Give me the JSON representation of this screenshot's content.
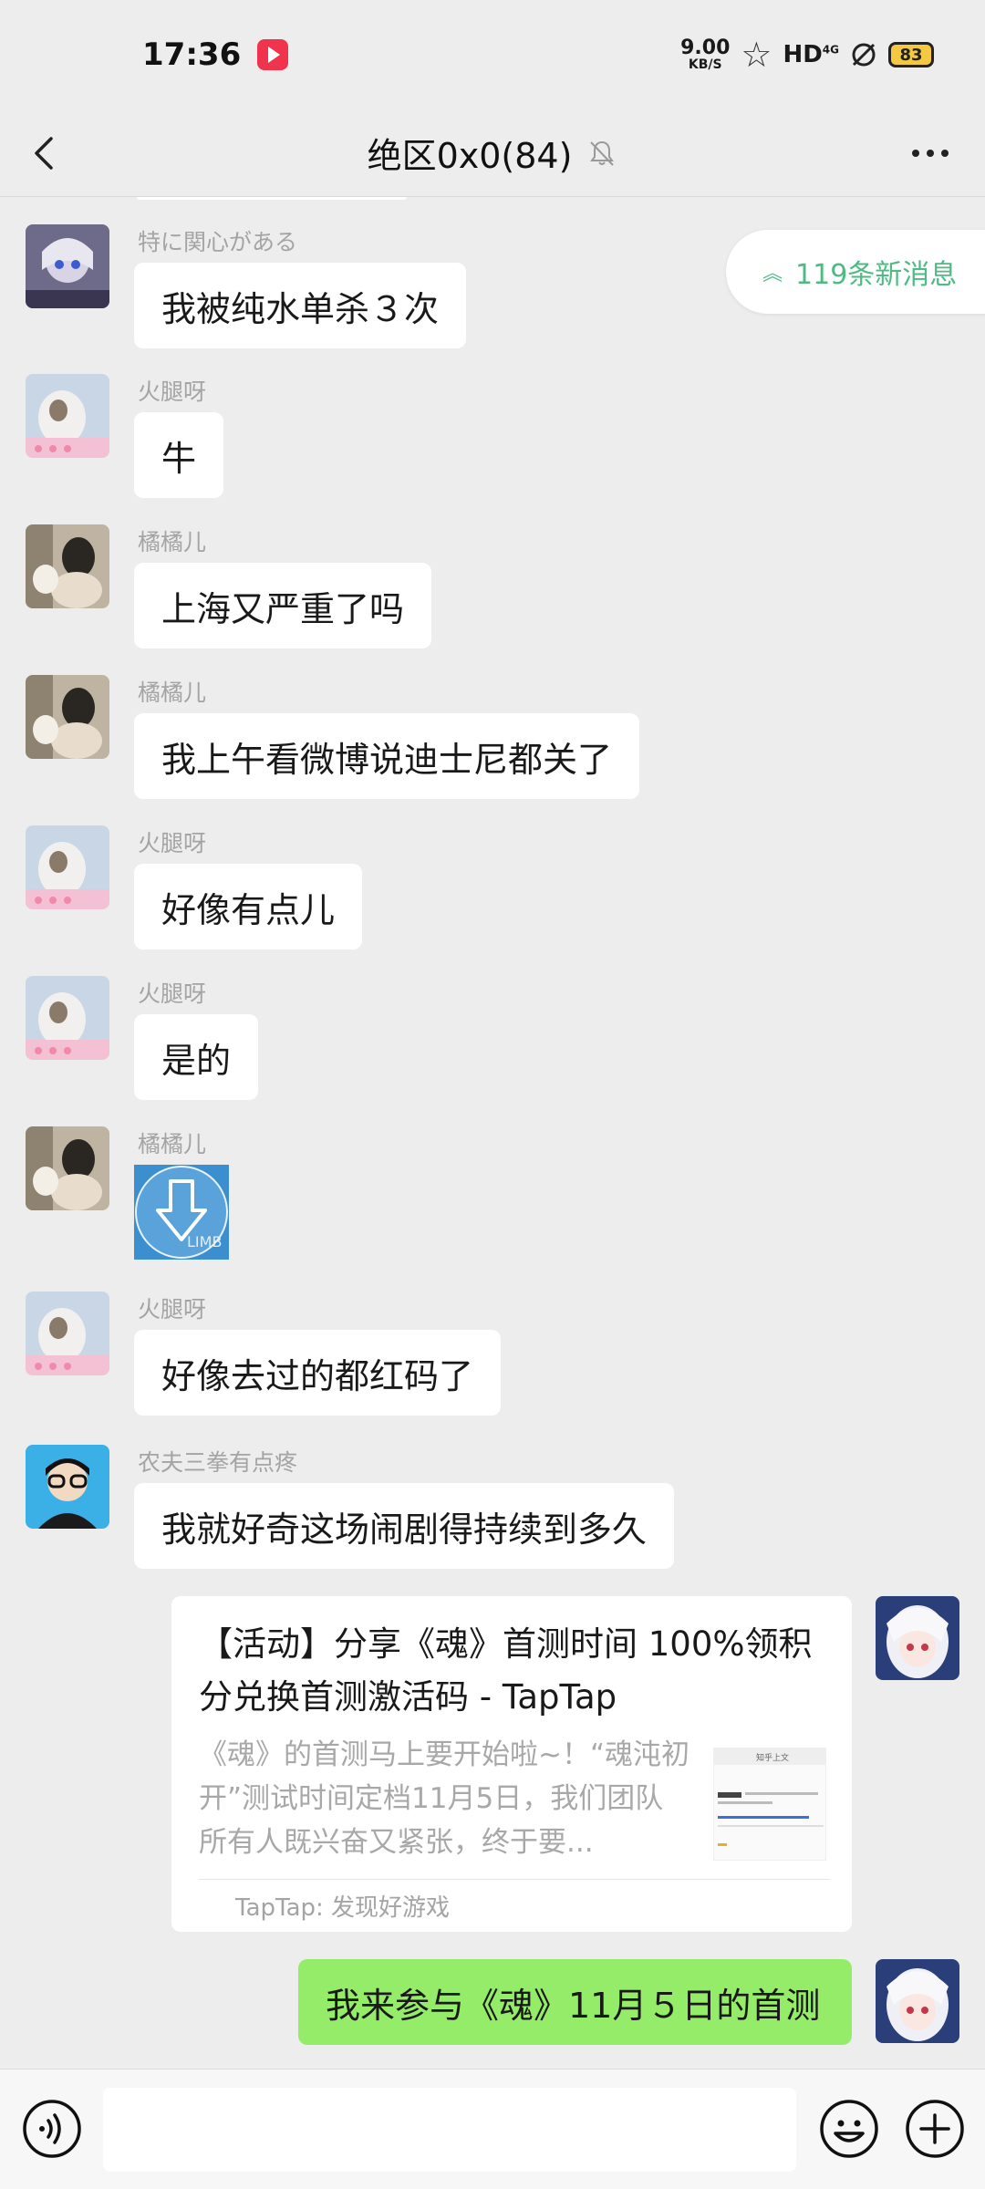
{
  "status": {
    "time": "17:36",
    "net_speed": "9.00",
    "net_unit": "KB/S",
    "network": "HD",
    "net_gen": "4G",
    "battery": "83"
  },
  "header": {
    "title": "绝区0x0(84)"
  },
  "new_messages": {
    "label": "119条新消息"
  },
  "messages": [
    {
      "sender": "特に関心がある",
      "text": "我被纯水单杀３次"
    },
    {
      "sender": "火腿呀",
      "text": "牛"
    },
    {
      "sender": "橘橘儿",
      "text": "上海又严重了吗"
    },
    {
      "sender": "橘橘儿",
      "text": "我上午看微博说迪士尼都关了"
    },
    {
      "sender": "火腿呀",
      "text": "好像有点儿"
    },
    {
      "sender": "火腿呀",
      "text": "是的"
    },
    {
      "sender": "橘橘儿",
      "image_caption": "LIMB"
    },
    {
      "sender": "火腿呀",
      "text": "好像去过的都红码了"
    },
    {
      "sender": "农夫三拳有点疼",
      "text": "我就好奇这场闹剧得持续到多久"
    }
  ],
  "link_card": {
    "title": "【活动】分享《魂》首测时间 100%领积分兑换首测激活码 - TapTap",
    "description": "《魂》的首测马上要开始啦~！“魂沌初开”测试时间定档11月5日，我们团队所有人既兴奋又紧张，终于要...",
    "source": "TapTap: 发现好游戏",
    "thumb_heading": "知乎上文"
  },
  "my_message": {
    "text": "我来参与《魂》11月５日的首测"
  },
  "colors": {
    "accent_green": "#95ec69",
    "new_msg_green": "#4dbb83",
    "background": "#ededed"
  }
}
